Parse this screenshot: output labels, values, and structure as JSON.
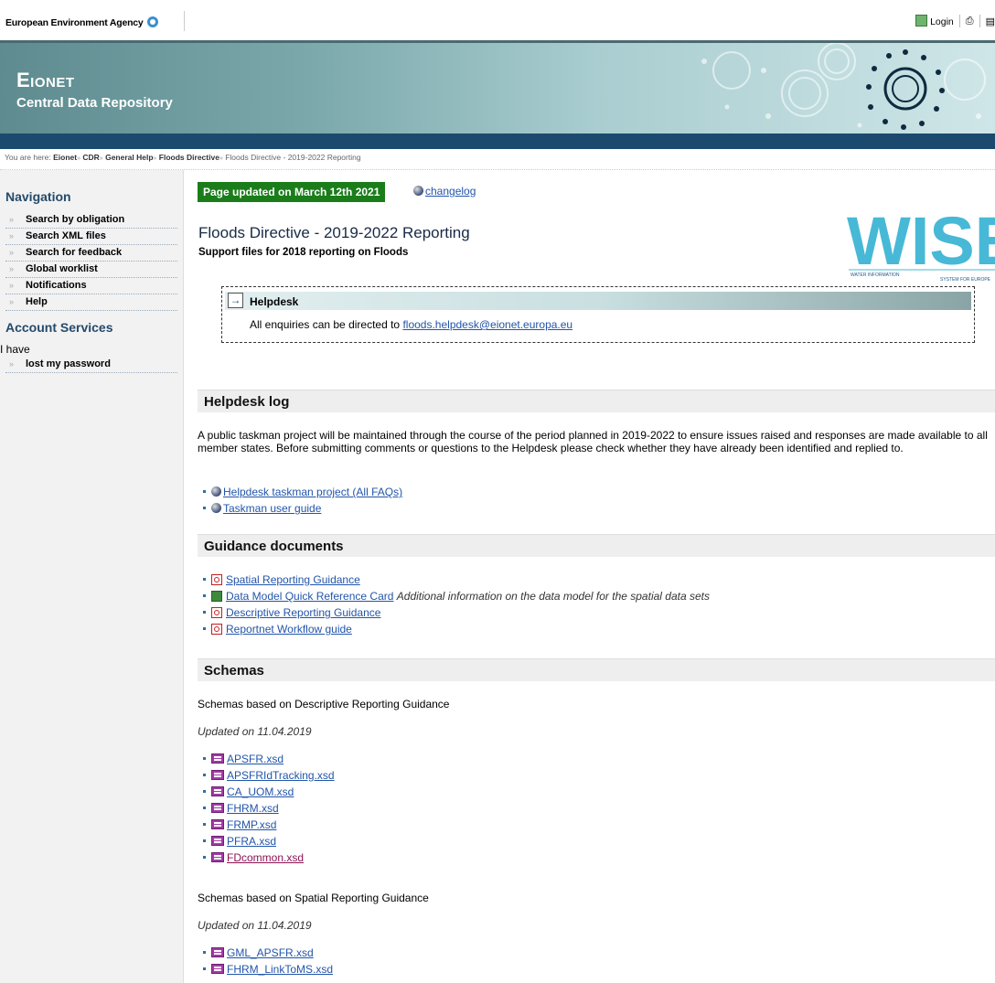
{
  "topbar": {
    "agency": "European Environment Agency",
    "login": "Login"
  },
  "header": {
    "title": "Eionet",
    "subtitle": "Central Data Repository"
  },
  "breadcrumb": {
    "prefix": "You are here:",
    "items": [
      "Eionet",
      "CDR",
      "General Help",
      "Floods Directive"
    ],
    "current": "Floods Directive - 2019-2022 Reporting"
  },
  "sidebar": {
    "navigation_title": "Navigation",
    "nav_items": [
      "Search by obligation",
      "Search XML files",
      "Search for feedback",
      "Global worklist",
      "Notifications",
      "Help"
    ],
    "account_title": "Account Services",
    "account_intro": "I have",
    "account_items": [
      "lost my password"
    ]
  },
  "content": {
    "updated": "Page updated on March 12th 2021",
    "changelog": "changelog",
    "title": "Floods Directive - 2019-2022 Reporting",
    "subtitle": "Support files for 2018 reporting on Floods",
    "logo_text": "WISE",
    "logo_sub1": "WATER INFORMATION",
    "logo_sub2": "SYSTEM FOR EUROPE",
    "helpdesk": {
      "title": "Helpdesk",
      "text": "All enquiries can be directed to",
      "email": "floods.helpdesk@eionet.europa.eu"
    },
    "helpdesk_log": {
      "title": "Helpdesk log",
      "text": "A public taskman project will be maintained through the course of the period planned in 2019-2022 to ensure issues raised and responses are made available to all member states. Before submitting comments or questions to the Helpdesk please check whether they have already been identified and replied to.",
      "links": [
        "Helpdesk taskman project (All FAQs)",
        "Taskman user guide"
      ]
    },
    "guidance": {
      "title": "Guidance documents",
      "links": [
        {
          "label": "Spatial Reporting Guidance",
          "icon": "pdf-icon",
          "note": ""
        },
        {
          "label": "Data Model Quick Reference Card",
          "icon": "excel-icon",
          "note": "Additional information on the data model for the spatial data sets"
        },
        {
          "label": "Descriptive Reporting Guidance",
          "icon": "pdf-icon",
          "note": ""
        },
        {
          "label": "Reportnet Workflow guide",
          "icon": "pdf-icon",
          "note": ""
        }
      ]
    },
    "schemas": {
      "title": "Schemas",
      "descriptive_intro": "Schemas based on Descriptive Reporting Guidance",
      "descriptive_updated": "Updated on 11.04.2019",
      "descriptive_files": [
        "APSFR.xsd",
        "APSFRIdTracking.xsd",
        "CA_UOM.xsd",
        "FHRM.xsd",
        "FRMP.xsd",
        "PFRA.xsd",
        "FDcommon.xsd"
      ],
      "spatial_intro": "Schemas based on Spatial Reporting Guidance",
      "spatial_updated": "Updated on 11.04.2019",
      "spatial_files": [
        "GML_APSFR.xsd",
        "FHRM_LinkToMS.xsd"
      ]
    }
  }
}
